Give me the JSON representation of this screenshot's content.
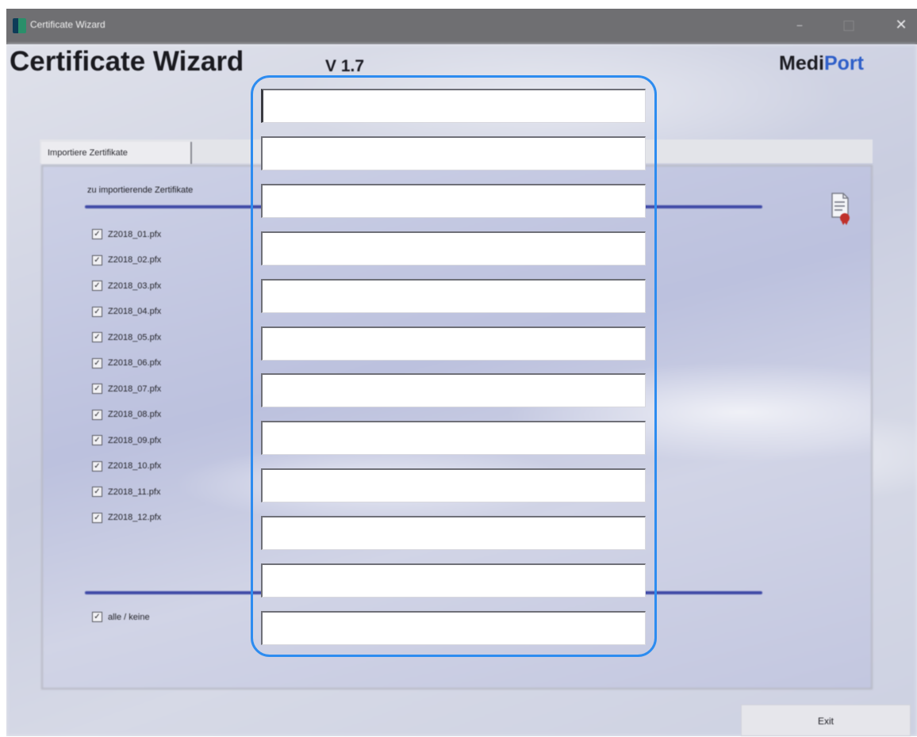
{
  "window": {
    "title": "Certificate Wizard"
  },
  "header": {
    "title": "Certificate Wizard",
    "version": "V 1.7",
    "brand_part1": "Medi",
    "brand_part2": "Port"
  },
  "tab": {
    "label": "Importiere Zertifikate"
  },
  "group": {
    "label": "zu importierende Zertifikate"
  },
  "certificates": [
    {
      "label": "Z2018_01.pfx",
      "checked": true
    },
    {
      "label": "Z2018_02.pfx",
      "checked": true
    },
    {
      "label": "Z2018_03.pfx",
      "checked": true
    },
    {
      "label": "Z2018_04.pfx",
      "checked": true
    },
    {
      "label": "Z2018_05.pfx",
      "checked": true
    },
    {
      "label": "Z2018_06.pfx",
      "checked": true
    },
    {
      "label": "Z2018_07.pfx",
      "checked": true
    },
    {
      "label": "Z2018_08.pfx",
      "checked": true
    },
    {
      "label": "Z2018_09.pfx",
      "checked": true
    },
    {
      "label": "Z2018_10.pfx",
      "checked": true
    },
    {
      "label": "Z2018_11.pfx",
      "checked": true
    },
    {
      "label": "Z2018_12.pfx",
      "checked": true
    }
  ],
  "all_toggle": {
    "label": "alle / keine",
    "checked": true
  },
  "buttons": {
    "exit": "Exit"
  },
  "input_fields": [
    "",
    "",
    "",
    "",
    "",
    "",
    "",
    "",
    "",
    "",
    "",
    ""
  ],
  "colors": {
    "titlebar": "#6f6f72",
    "accent_rule": "#3f4aa6",
    "overlay_border": "#2d8cf0",
    "brand_blue": "#2f5fc8"
  }
}
